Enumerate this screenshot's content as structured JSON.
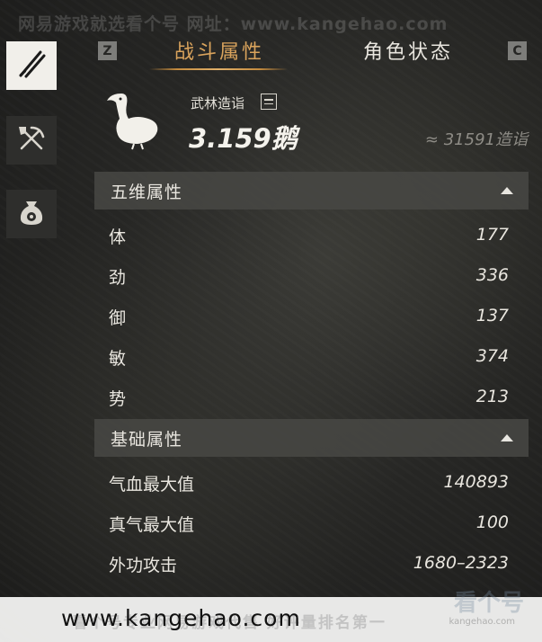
{
  "watermark": {
    "top": "网易游戏就选看个号  网址：www.kangehao.com",
    "banner": "www.kangehao.com",
    "banner_faint": "看个号专业网易游戏代售   好评量排名第一",
    "logo": "看个号",
    "logo_sub": "kangehao.com"
  },
  "sidebar": {
    "items": [
      {
        "name": "weapon-icon",
        "active": true
      },
      {
        "name": "tools-icon",
        "active": false
      },
      {
        "name": "money-bag-icon",
        "active": false
      }
    ]
  },
  "tabs": {
    "key_left": "Z",
    "key_right": "C",
    "items": [
      {
        "label": "战斗属性",
        "active": true
      },
      {
        "label": "角色状态",
        "active": false
      }
    ]
  },
  "header": {
    "title": "武林造诣",
    "value": "3.159鹅",
    "approx": "≈ 31591造诣"
  },
  "sections": [
    {
      "title": "五维属性",
      "rows": [
        {
          "label": "体",
          "value": "177"
        },
        {
          "label": "劲",
          "value": "336"
        },
        {
          "label": "御",
          "value": "137"
        },
        {
          "label": "敏",
          "value": "374"
        },
        {
          "label": "势",
          "value": "213"
        }
      ]
    },
    {
      "title": "基础属性",
      "rows": [
        {
          "label": "气血最大值",
          "value": "140893"
        },
        {
          "label": "真气最大值",
          "value": "100"
        },
        {
          "label": "外功攻击",
          "value": "1680–2323"
        }
      ]
    }
  ],
  "colors": {
    "accent": "#d9a35c",
    "panel": "#484844",
    "background": "#262624"
  }
}
